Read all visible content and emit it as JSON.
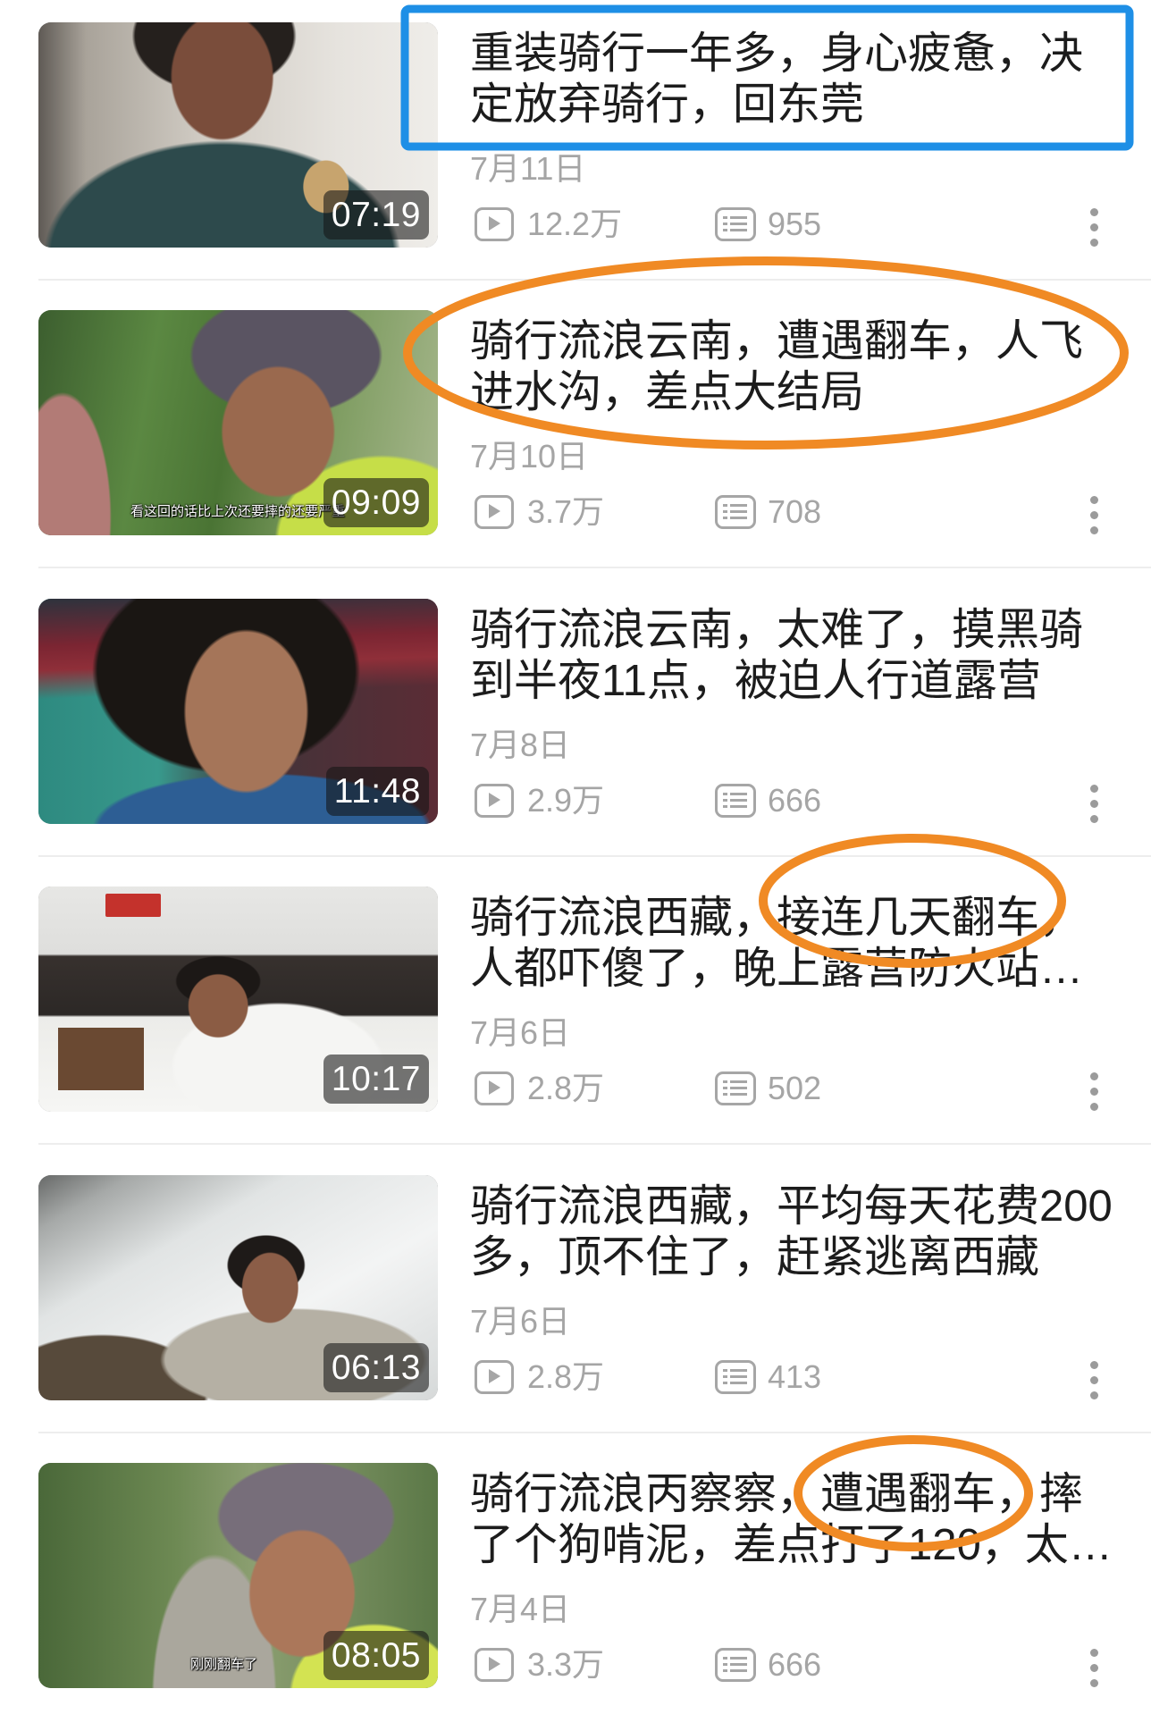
{
  "annotation_colors": {
    "box": "#1E8FE6",
    "ellipse": "#F08A24"
  },
  "icons": {
    "views": "play-icon",
    "comments": "danmaku-icon",
    "more": "more-vertical-icon"
  },
  "items": [
    {
      "title_lines": [
        "重装骑行一年多，身心疲惫，决",
        "定放弃骑行，回东莞"
      ],
      "duration": "07:19",
      "date": "7月11日",
      "views": "12.2万",
      "comments": "955"
    },
    {
      "title_lines": [
        "骑行流浪云南，遭遇翻车，人飞",
        "进水沟，差点大结局"
      ],
      "duration": "09:09",
      "date": "7月10日",
      "views": "3.7万",
      "comments": "708",
      "thumbnail_caption": "看这回的话比上次还要摔的还要严重"
    },
    {
      "title_lines": [
        "骑行流浪云南，太难了，摸黑骑",
        "到半夜11点，被迫人行道露营"
      ],
      "duration": "11:48",
      "date": "7月8日",
      "views": "2.9万",
      "comments": "666"
    },
    {
      "title_lines": [
        "骑行流浪西藏，接连几天翻车，",
        "人都吓傻了，晚上露营防火站…"
      ],
      "duration": "10:17",
      "date": "7月6日",
      "views": "2.8万",
      "comments": "502"
    },
    {
      "title_lines": [
        "骑行流浪西藏，平均每天花费200",
        "多，顶不住了，赶紧逃离西藏"
      ],
      "duration": "06:13",
      "date": "7月6日",
      "views": "2.8万",
      "comments": "413"
    },
    {
      "title_lines": [
        "骑行流浪丙察察，遭遇翻车，摔",
        "了个狗啃泥，差点打了120，太…"
      ],
      "duration": "08:05",
      "date": "7月4日",
      "views": "3.3万",
      "comments": "666",
      "thumbnail_caption": "刚刚翻车了"
    }
  ]
}
